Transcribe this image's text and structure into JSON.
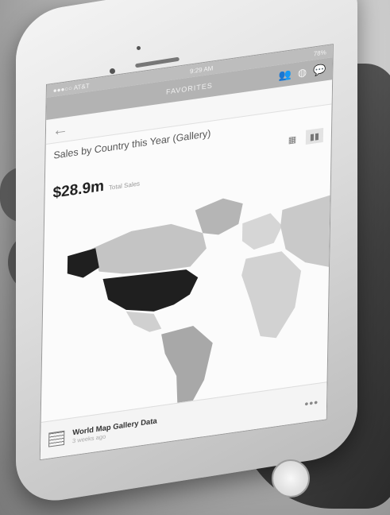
{
  "status_bar": {
    "carrier": "●●●○○ AT&T",
    "time": "9:29 AM",
    "battery": "78%"
  },
  "nav": {
    "title": "FAVORITES"
  },
  "chart": {
    "title": "Sales by Country this Year (Gallery)",
    "total_value": "$28.9m",
    "total_label": "Total Sales"
  },
  "dataset": {
    "name": "World Map Gallery Data",
    "updated": "3 weeks ago",
    "more": "•••"
  },
  "icons": {
    "back": "back-arrow-icon",
    "table_view": "grid-icon",
    "chart_view": "bar-chart-icon",
    "users": "users-icon",
    "globe": "globe-icon",
    "chat": "chat-icon"
  }
}
